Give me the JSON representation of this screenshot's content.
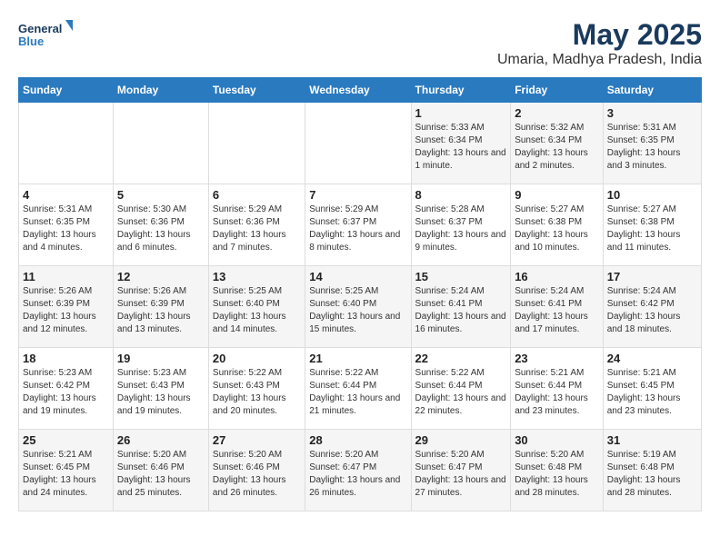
{
  "logo": {
    "line1": "General",
    "line2": "Blue"
  },
  "title": "May 2025",
  "subtitle": "Umaria, Madhya Pradesh, India",
  "days_of_week": [
    "Sunday",
    "Monday",
    "Tuesday",
    "Wednesday",
    "Thursday",
    "Friday",
    "Saturday"
  ],
  "weeks": [
    [
      {
        "day": "",
        "info": ""
      },
      {
        "day": "",
        "info": ""
      },
      {
        "day": "",
        "info": ""
      },
      {
        "day": "",
        "info": ""
      },
      {
        "day": "1",
        "sunrise": "Sunrise: 5:33 AM",
        "sunset": "Sunset: 6:34 PM",
        "daylight": "Daylight: 13 hours and 1 minute."
      },
      {
        "day": "2",
        "sunrise": "Sunrise: 5:32 AM",
        "sunset": "Sunset: 6:34 PM",
        "daylight": "Daylight: 13 hours and 2 minutes."
      },
      {
        "day": "3",
        "sunrise": "Sunrise: 5:31 AM",
        "sunset": "Sunset: 6:35 PM",
        "daylight": "Daylight: 13 hours and 3 minutes."
      }
    ],
    [
      {
        "day": "4",
        "sunrise": "Sunrise: 5:31 AM",
        "sunset": "Sunset: 6:35 PM",
        "daylight": "Daylight: 13 hours and 4 minutes."
      },
      {
        "day": "5",
        "sunrise": "Sunrise: 5:30 AM",
        "sunset": "Sunset: 6:36 PM",
        "daylight": "Daylight: 13 hours and 6 minutes."
      },
      {
        "day": "6",
        "sunrise": "Sunrise: 5:29 AM",
        "sunset": "Sunset: 6:36 PM",
        "daylight": "Daylight: 13 hours and 7 minutes."
      },
      {
        "day": "7",
        "sunrise": "Sunrise: 5:29 AM",
        "sunset": "Sunset: 6:37 PM",
        "daylight": "Daylight: 13 hours and 8 minutes."
      },
      {
        "day": "8",
        "sunrise": "Sunrise: 5:28 AM",
        "sunset": "Sunset: 6:37 PM",
        "daylight": "Daylight: 13 hours and 9 minutes."
      },
      {
        "day": "9",
        "sunrise": "Sunrise: 5:27 AM",
        "sunset": "Sunset: 6:38 PM",
        "daylight": "Daylight: 13 hours and 10 minutes."
      },
      {
        "day": "10",
        "sunrise": "Sunrise: 5:27 AM",
        "sunset": "Sunset: 6:38 PM",
        "daylight": "Daylight: 13 hours and 11 minutes."
      }
    ],
    [
      {
        "day": "11",
        "sunrise": "Sunrise: 5:26 AM",
        "sunset": "Sunset: 6:39 PM",
        "daylight": "Daylight: 13 hours and 12 minutes."
      },
      {
        "day": "12",
        "sunrise": "Sunrise: 5:26 AM",
        "sunset": "Sunset: 6:39 PM",
        "daylight": "Daylight: 13 hours and 13 minutes."
      },
      {
        "day": "13",
        "sunrise": "Sunrise: 5:25 AM",
        "sunset": "Sunset: 6:40 PM",
        "daylight": "Daylight: 13 hours and 14 minutes."
      },
      {
        "day": "14",
        "sunrise": "Sunrise: 5:25 AM",
        "sunset": "Sunset: 6:40 PM",
        "daylight": "Daylight: 13 hours and 15 minutes."
      },
      {
        "day": "15",
        "sunrise": "Sunrise: 5:24 AM",
        "sunset": "Sunset: 6:41 PM",
        "daylight": "Daylight: 13 hours and 16 minutes."
      },
      {
        "day": "16",
        "sunrise": "Sunrise: 5:24 AM",
        "sunset": "Sunset: 6:41 PM",
        "daylight": "Daylight: 13 hours and 17 minutes."
      },
      {
        "day": "17",
        "sunrise": "Sunrise: 5:24 AM",
        "sunset": "Sunset: 6:42 PM",
        "daylight": "Daylight: 13 hours and 18 minutes."
      }
    ],
    [
      {
        "day": "18",
        "sunrise": "Sunrise: 5:23 AM",
        "sunset": "Sunset: 6:42 PM",
        "daylight": "Daylight: 13 hours and 19 minutes."
      },
      {
        "day": "19",
        "sunrise": "Sunrise: 5:23 AM",
        "sunset": "Sunset: 6:43 PM",
        "daylight": "Daylight: 13 hours and 19 minutes."
      },
      {
        "day": "20",
        "sunrise": "Sunrise: 5:22 AM",
        "sunset": "Sunset: 6:43 PM",
        "daylight": "Daylight: 13 hours and 20 minutes."
      },
      {
        "day": "21",
        "sunrise": "Sunrise: 5:22 AM",
        "sunset": "Sunset: 6:44 PM",
        "daylight": "Daylight: 13 hours and 21 minutes."
      },
      {
        "day": "22",
        "sunrise": "Sunrise: 5:22 AM",
        "sunset": "Sunset: 6:44 PM",
        "daylight": "Daylight: 13 hours and 22 minutes."
      },
      {
        "day": "23",
        "sunrise": "Sunrise: 5:21 AM",
        "sunset": "Sunset: 6:44 PM",
        "daylight": "Daylight: 13 hours and 23 minutes."
      },
      {
        "day": "24",
        "sunrise": "Sunrise: 5:21 AM",
        "sunset": "Sunset: 6:45 PM",
        "daylight": "Daylight: 13 hours and 23 minutes."
      }
    ],
    [
      {
        "day": "25",
        "sunrise": "Sunrise: 5:21 AM",
        "sunset": "Sunset: 6:45 PM",
        "daylight": "Daylight: 13 hours and 24 minutes."
      },
      {
        "day": "26",
        "sunrise": "Sunrise: 5:20 AM",
        "sunset": "Sunset: 6:46 PM",
        "daylight": "Daylight: 13 hours and 25 minutes."
      },
      {
        "day": "27",
        "sunrise": "Sunrise: 5:20 AM",
        "sunset": "Sunset: 6:46 PM",
        "daylight": "Daylight: 13 hours and 26 minutes."
      },
      {
        "day": "28",
        "sunrise": "Sunrise: 5:20 AM",
        "sunset": "Sunset: 6:47 PM",
        "daylight": "Daylight: 13 hours and 26 minutes."
      },
      {
        "day": "29",
        "sunrise": "Sunrise: 5:20 AM",
        "sunset": "Sunset: 6:47 PM",
        "daylight": "Daylight: 13 hours and 27 minutes."
      },
      {
        "day": "30",
        "sunrise": "Sunrise: 5:20 AM",
        "sunset": "Sunset: 6:48 PM",
        "daylight": "Daylight: 13 hours and 28 minutes."
      },
      {
        "day": "31",
        "sunrise": "Sunrise: 5:19 AM",
        "sunset": "Sunset: 6:48 PM",
        "daylight": "Daylight: 13 hours and 28 minutes."
      }
    ]
  ]
}
